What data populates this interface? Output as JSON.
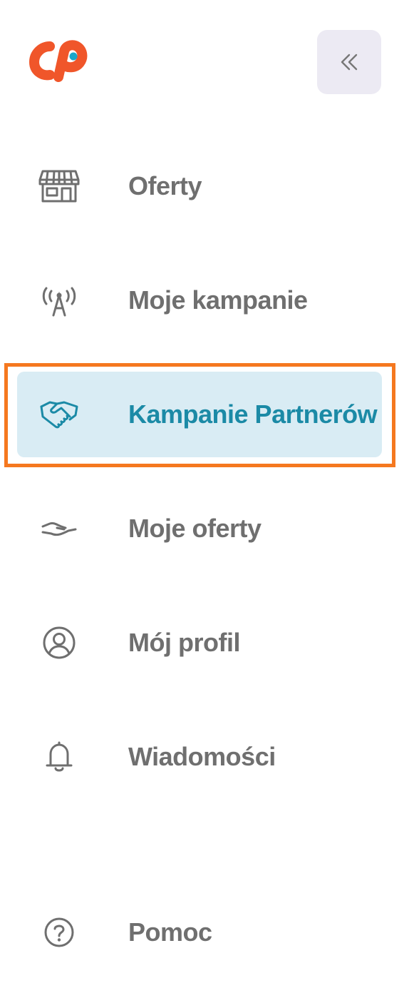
{
  "nav": {
    "items": [
      {
        "label": "Oferty",
        "icon": "storefront-icon"
      },
      {
        "label": "Moje kampanie",
        "icon": "broadcast-antenna-icon"
      },
      {
        "label": "Kampanie Partnerów",
        "icon": "handshake-icon",
        "active": true
      },
      {
        "label": "Moje oferty",
        "icon": "offer-hand-icon"
      },
      {
        "label": "Mój profil",
        "icon": "user-circle-icon"
      },
      {
        "label": "Wiadomości",
        "icon": "bell-icon"
      }
    ],
    "help": {
      "label": "Pomoc",
      "icon": "help-circle-icon"
    }
  },
  "icons": {
    "logo": "cp-logo",
    "collapse": "double-chevron-left-icon"
  },
  "colors": {
    "brand": "#f0562a",
    "active_text": "#1b8aa6",
    "active_bg": "#d9ecf4",
    "text": "#6f6f6f",
    "collapse_bg": "#eceaf3",
    "highlight_border": "#f5781f"
  }
}
